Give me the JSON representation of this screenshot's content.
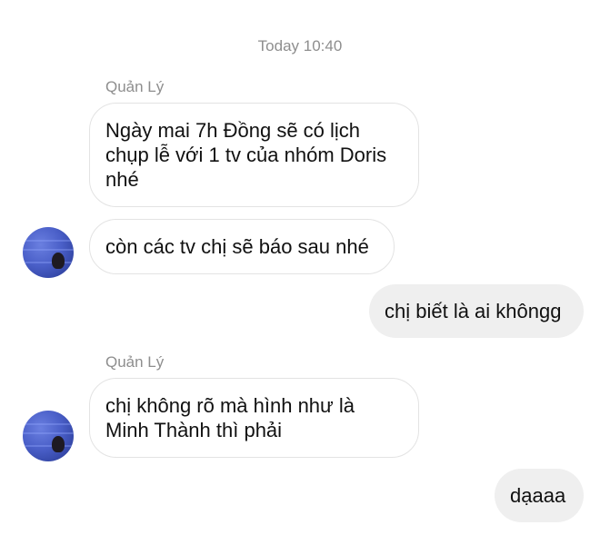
{
  "conversation": {
    "timestamp": "Today 10:40",
    "messages": [
      {
        "sender": "Quản Lý",
        "direction": "incoming",
        "text": "Ngày mai 7h Đồng sẽ có lịch chụp lễ với 1 tv của nhóm Doris nhé"
      },
      {
        "direction": "incoming",
        "text": "còn các tv chị sẽ báo sau nhé"
      },
      {
        "direction": "outgoing",
        "text": "chị biết là ai khôngg"
      },
      {
        "sender": "Quản Lý",
        "direction": "incoming",
        "text": "chị không rõ mà hình như là Minh Thành thì phải"
      },
      {
        "direction": "outgoing",
        "text": "dạaaa"
      }
    ]
  },
  "colors": {
    "incoming_bubble_bg": "#ffffff",
    "incoming_bubble_border": "#e3e3e3",
    "outgoing_bubble_bg": "#efefef",
    "meta_text": "#8e8e8e",
    "avatar_accent": "#4a5fc8"
  }
}
